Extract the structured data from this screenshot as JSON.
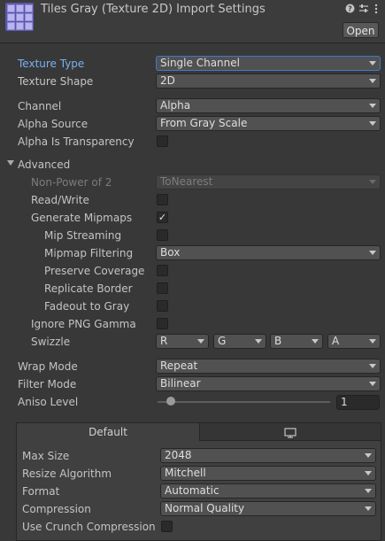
{
  "header": {
    "title": "Tiles Gray (Texture 2D) Import Settings",
    "icons": [
      "help-icon",
      "preset-icon",
      "more-icon"
    ],
    "open_label": "Open"
  },
  "fields": {
    "texture_type": {
      "label": "Texture Type",
      "value": "Single Channel"
    },
    "texture_shape": {
      "label": "Texture Shape",
      "value": "2D"
    },
    "channel": {
      "label": "Channel",
      "value": "Alpha"
    },
    "alpha_source": {
      "label": "Alpha Source",
      "value": "From Gray Scale"
    },
    "alpha_is_transparency": {
      "label": "Alpha Is Transparency",
      "checked": false
    },
    "advanced": {
      "label": "Advanced",
      "expanded": true
    },
    "non_power_of_2": {
      "label": "Non-Power of 2",
      "value": "ToNearest"
    },
    "read_write": {
      "label": "Read/Write",
      "checked": false
    },
    "generate_mipmaps": {
      "label": "Generate Mipmaps",
      "checked": true,
      "check_glyph": "✓"
    },
    "mip_streaming": {
      "label": "Mip Streaming",
      "checked": false
    },
    "mipmap_filtering": {
      "label": "Mipmap Filtering",
      "value": "Box"
    },
    "preserve_coverage": {
      "label": "Preserve Coverage",
      "checked": false
    },
    "replicate_border": {
      "label": "Replicate Border",
      "checked": false
    },
    "fadeout_to_gray": {
      "label": "Fadeout to Gray",
      "checked": false
    },
    "ignore_png_gamma": {
      "label": "Ignore PNG Gamma",
      "checked": false
    },
    "swizzle": {
      "label": "Swizzle",
      "values": [
        "R",
        "G",
        "B",
        "A"
      ]
    },
    "wrap_mode": {
      "label": "Wrap Mode",
      "value": "Repeat"
    },
    "filter_mode": {
      "label": "Filter Mode",
      "value": "Bilinear"
    },
    "aniso_level": {
      "label": "Aniso Level",
      "value": "1"
    }
  },
  "platform": {
    "tabs": [
      {
        "label": "Default",
        "active": true
      },
      {
        "label": "",
        "icon": "monitor-icon",
        "active": false
      }
    ],
    "max_size": {
      "label": "Max Size",
      "value": "2048"
    },
    "resize_algorithm": {
      "label": "Resize Algorithm",
      "value": "Mitchell"
    },
    "format": {
      "label": "Format",
      "value": "Automatic"
    },
    "compression": {
      "label": "Compression",
      "value": "Normal Quality"
    },
    "use_crunch": {
      "label": "Use Crunch Compression",
      "checked": false
    }
  },
  "colors": {
    "background": "#383838",
    "accent": "#7ab0f0",
    "focus_border": "#3a7bd0"
  }
}
